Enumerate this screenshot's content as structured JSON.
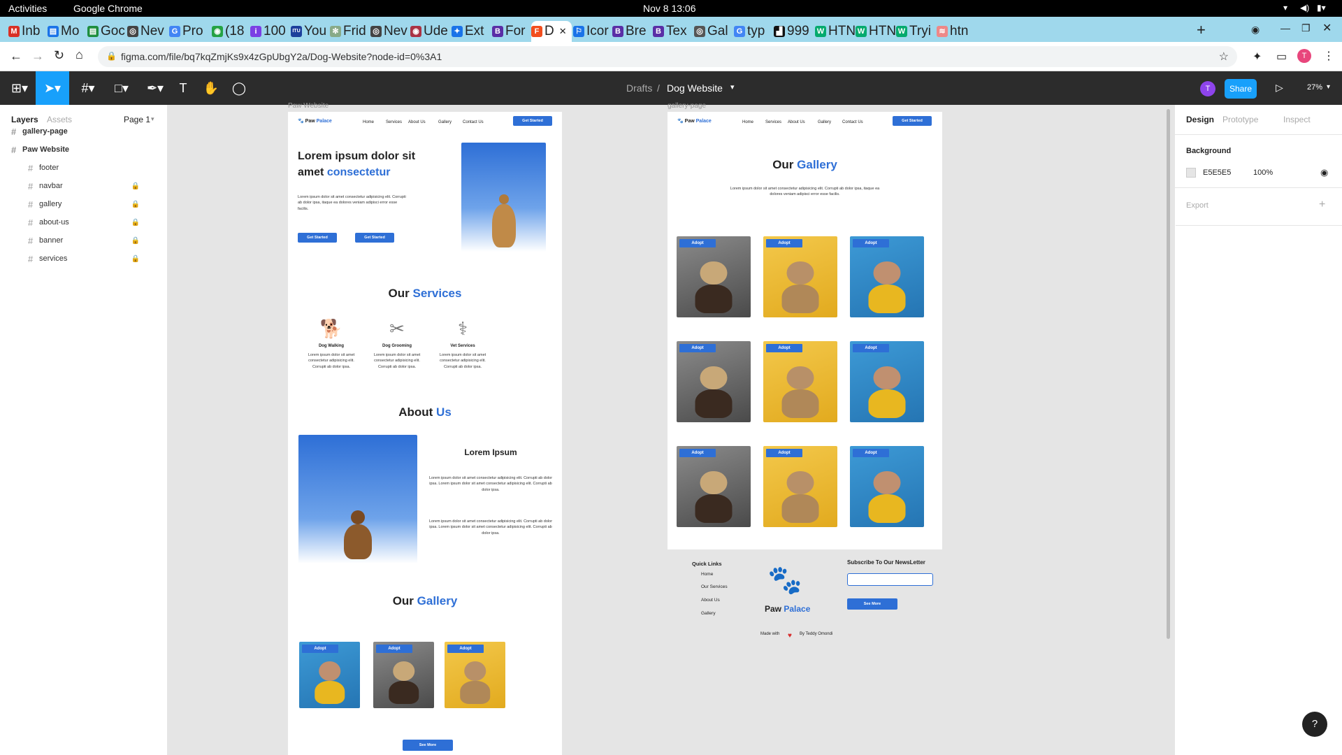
{
  "gnome": {
    "activities": "Activities",
    "app": "Google Chrome",
    "clock": "Nov 8  13:06"
  },
  "tabs": [
    {
      "label": "Inb",
      "color": "#d93025",
      "g": "M"
    },
    {
      "label": "Mo",
      "color": "#1a73e8",
      "g": "▤"
    },
    {
      "label": "Goc",
      "color": "#1e8e3e",
      "g": "▤"
    },
    {
      "label": "Nev",
      "color": "#444",
      "g": "◎"
    },
    {
      "label": "Pro",
      "color": "#4285f4",
      "g": "G"
    },
    {
      "label": "(18",
      "color": "#25a244",
      "g": "◉"
    },
    {
      "label": "100",
      "color": "#7b3fe4",
      "g": "i"
    },
    {
      "label": "You",
      "color": "#1d3f9b",
      "g": "ITU"
    },
    {
      "label": "Frid",
      "color": "#8a8",
      "g": "✻"
    },
    {
      "label": "Nev",
      "color": "#444",
      "g": "◎"
    },
    {
      "label": "Ude",
      "color": "#a34",
      "g": "◉"
    },
    {
      "label": "Ext",
      "color": "#1a73e8",
      "g": "✦"
    },
    {
      "label": "For",
      "color": "#5a2ea6",
      "g": "B"
    },
    {
      "label": "D",
      "color": "#f24e1e",
      "g": "F"
    },
    {
      "label": "Icor",
      "color": "#1a73e8",
      "g": "⚐"
    },
    {
      "label": "Bre",
      "color": "#5a2ea6",
      "g": "B"
    },
    {
      "label": "Tex",
      "color": "#5a2ea6",
      "g": "B"
    },
    {
      "label": "Gal",
      "color": "#555",
      "g": "◎"
    },
    {
      "label": "typ",
      "color": "#4285f4",
      "g": "G"
    },
    {
      "label": "999",
      "color": "#111",
      "g": "▟"
    },
    {
      "label": "HTN",
      "color": "#04aa6d",
      "g": "W"
    },
    {
      "label": "HTN",
      "color": "#04aa6d",
      "g": "W"
    },
    {
      "label": "Tryi",
      "color": "#04aa6d",
      "g": "W"
    },
    {
      "label": "htn",
      "color": "#e88",
      "g": "≋"
    }
  ],
  "url": "figma.com/file/bq7kqZmjKs9x4zGpUbgY2a/Dog-Website?node-id=0%3A1",
  "figma": {
    "breadcrumb_root": "Drafts",
    "breadcrumb_sep": "/",
    "file_name": "Dog Website",
    "share": "Share",
    "zoom": "27%",
    "avatar": "T"
  },
  "left": {
    "tab_layers": "Layers",
    "tab_assets": "Assets",
    "page": "Page 1",
    "layers": [
      {
        "name": "gallery-page",
        "top": true,
        "lock": false
      },
      {
        "name": "Paw Website",
        "top": true,
        "lock": false
      },
      {
        "name": "footer",
        "top": false,
        "lock": false
      },
      {
        "name": "navbar",
        "top": false,
        "lock": true
      },
      {
        "name": "gallery",
        "top": false,
        "lock": true
      },
      {
        "name": "about-us",
        "top": false,
        "lock": true
      },
      {
        "name": "banner",
        "top": false,
        "lock": true
      },
      {
        "name": "services",
        "top": false,
        "lock": true
      }
    ]
  },
  "right": {
    "tab_design": "Design",
    "tab_prototype": "Prototype",
    "tab_inspect": "Inspect",
    "bg_label": "Background",
    "bg_hex": "E5E5E5",
    "bg_opacity": "100%",
    "export_label": "Export"
  },
  "site": {
    "frame1_label": "Paw Website",
    "frame2_label": "gallery-page",
    "logo_a": "Paw",
    "logo_b": "Palace",
    "nav": [
      "Home",
      "Services",
      "About Us",
      "Gallery",
      "Contact Us"
    ],
    "nav_cta": "Get Started",
    "hero_title_a": "Lorem ipsum dolor sit amet",
    "hero_title_b": "consectetur",
    "hero_text": "Lorem ipsum dolor sit amet consectetur adipisicing elit. Corrupti ab dolor ipsa, itaque ea dolores veniam adipisci error esse facilis.",
    "hero_btn1": "Get Started",
    "hero_btn2": "Get Started",
    "services_a": "Our",
    "services_b": "Services",
    "services": [
      {
        "title": "Dog Walking",
        "text": "Lorem ipsum dolor sit amet consectetur adipisicing elit. Corrupti ab dolor ipsa."
      },
      {
        "title": "Dog Grooming",
        "text": "Lorem ipsum dolor sit amet consectetur adipisicing elit. Corrupti ab dolor ipsa."
      },
      {
        "title": "Vet Services",
        "text": "Lorem ipsum dolor sit amet consectetur adipisicing elit. Corrupti ab dolor ipsa."
      }
    ],
    "about_a": "About",
    "about_b": "Us",
    "about_heading": "Lorem Ipsum",
    "about_p1": "Lorem ipsum dolor sit amet consectetur adipisicing elit. Corrupti ab dolor ipsa. Lorem ipsum dolor sit amet consectetur adipisicing elit. Corrupti ab dolor ipsa.",
    "about_p2": "Lorem ipsum dolor sit amet consectetur adipisicing elit. Corrupti ab dolor ipsa. Lorem ipsum dolor sit amet consectetur adipisicing elit. Corrupti ab dolor ipsa.",
    "gallery_a": "Our",
    "gallery_b": "Gallery",
    "adopt": "Adopt",
    "see_more": "See More",
    "gallery_text": "Lorem ipsum dolor sit amet consectetur adipisicing elit. Corrupti ab dolor ipsa, itaque ea dolores veniam adipisci error esse facilis.",
    "footer_quick": "Quick Links",
    "footer_links": [
      "Home",
      "Our Services",
      "About Us",
      "Gallery"
    ],
    "footer_subscribe": "Subscribe To Our NewsLetter",
    "footer_btn": "See More",
    "made_with": "Made with",
    "by": "By Teddy Omondi"
  }
}
